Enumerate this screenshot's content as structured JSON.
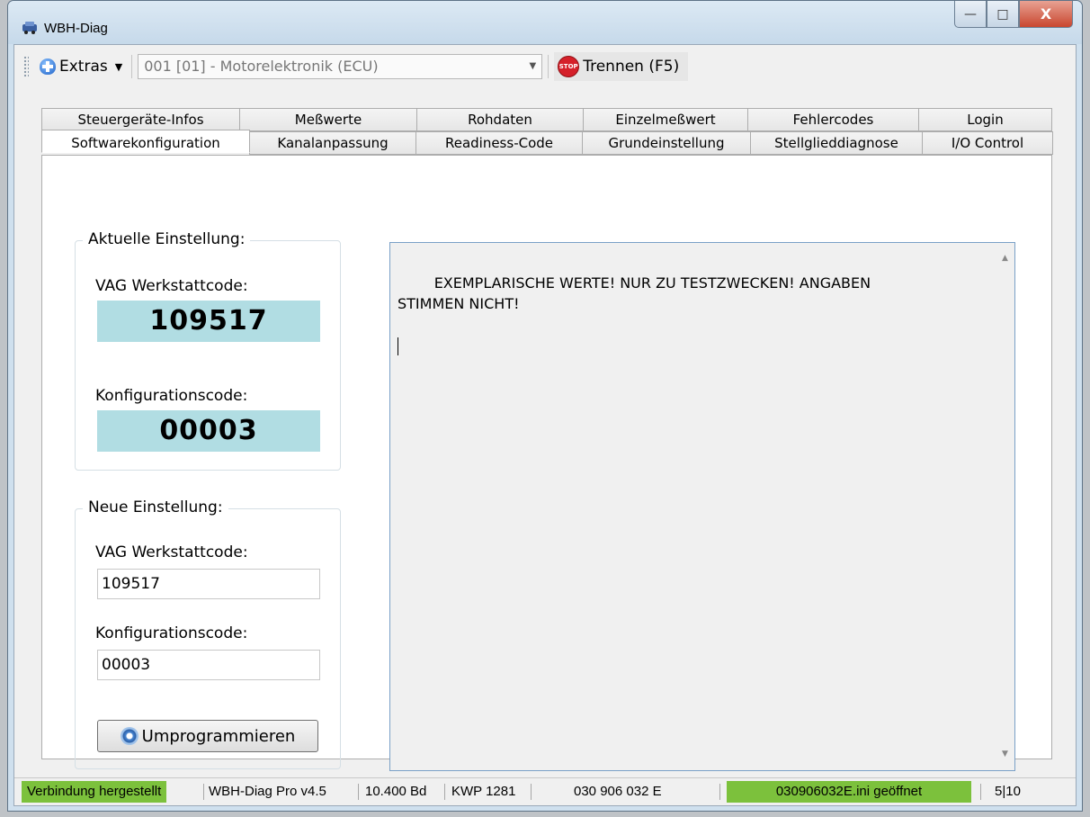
{
  "window": {
    "title": "WBH-Diag",
    "buttons": {
      "minimize": "—",
      "maximize": "□",
      "close": "X"
    }
  },
  "toolbar": {
    "extras_label": "Extras",
    "module_select": "001 [01] - Motorelektronik (ECU)",
    "disconnect_label": "Trennen (F5)",
    "stop_text": "STOP"
  },
  "tabs": {
    "row1": [
      "Steuergeräte-Infos",
      "Meßwerte",
      "Rohdaten",
      "Einzelmeßwert",
      "Fehlercodes",
      "Login"
    ],
    "row2": [
      "Softwarekonfiguration",
      "Kanalanpassung",
      "Readiness-Code",
      "Grundeinstellung",
      "Stellglieddiagnose",
      "I/O Control"
    ],
    "active": "Softwarekonfiguration"
  },
  "current": {
    "legend": "Aktuelle Einstellung:",
    "workshop_label": "VAG Werkstattcode:",
    "workshop_value": "109517",
    "config_label": "Konfigurationscode:",
    "config_value": "00003"
  },
  "new": {
    "legend": "Neue Einstellung:",
    "workshop_label": "VAG Werkstattcode:",
    "workshop_value": "109517",
    "config_label": "Konfigurationscode:",
    "config_value": "00003",
    "button_label": "Umprogrammieren"
  },
  "output": {
    "text": "EXEMPLARISCHE WERTE! NUR ZU TESTZWECKEN! ANGABEN\nSTIMMEN NICHT!"
  },
  "status": {
    "connection": "Verbindung hergestellt",
    "version": "WBH-Diag Pro v4.5",
    "baud": "10.400 Bd",
    "protocol": "KWP 1281",
    "part_number": "030 906 032 E",
    "ini_file": "030906032E.ini geöffnet",
    "count": "5|10"
  },
  "colors": {
    "status_green": "#7cc13c",
    "value_box": "#b1dde3",
    "stop_red": "#d5202a"
  }
}
